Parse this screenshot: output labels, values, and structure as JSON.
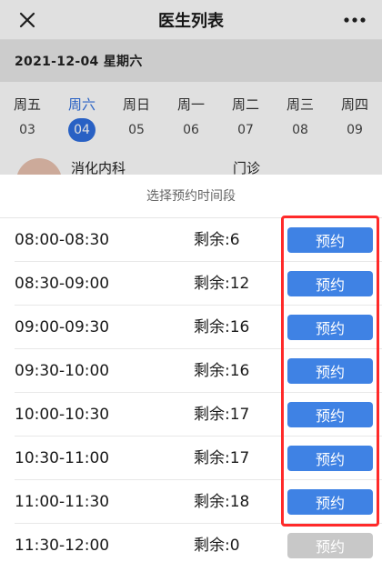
{
  "nav": {
    "title": "医生列表",
    "close_icon": "close-icon",
    "more_icon": "more-icon"
  },
  "date_bar": {
    "text": "2021-12-04 星期六"
  },
  "week": [
    {
      "name": "周五",
      "num": "03",
      "selected": false
    },
    {
      "name": "周六",
      "num": "04",
      "selected": true
    },
    {
      "name": "周日",
      "num": "05",
      "selected": false
    },
    {
      "name": "周一",
      "num": "06",
      "selected": false
    },
    {
      "name": "周二",
      "num": "07",
      "selected": false
    },
    {
      "name": "周三",
      "num": "08",
      "selected": false
    },
    {
      "name": "周四",
      "num": "09",
      "selected": false
    }
  ],
  "doctor": {
    "department": "消化内科",
    "visit_type": "门诊"
  },
  "sheet": {
    "title": "选择预约时间段",
    "slots": [
      {
        "time": "08:00-08:30",
        "remain": "剩余:6",
        "button": "预约",
        "available": true
      },
      {
        "time": "08:30-09:00",
        "remain": "剩余:12",
        "button": "预约",
        "available": true
      },
      {
        "time": "09:00-09:30",
        "remain": "剩余:16",
        "button": "预约",
        "available": true
      },
      {
        "time": "09:30-10:00",
        "remain": "剩余:16",
        "button": "预约",
        "available": true
      },
      {
        "time": "10:00-10:30",
        "remain": "剩余:17",
        "button": "预约",
        "available": true
      },
      {
        "time": "10:30-11:00",
        "remain": "剩余:17",
        "button": "预约",
        "available": true
      },
      {
        "time": "11:00-11:30",
        "remain": "剩余:18",
        "button": "预约",
        "available": true
      },
      {
        "time": "11:30-12:00",
        "remain": "剩余:0",
        "button": "预约",
        "available": false
      }
    ]
  },
  "colors": {
    "accent": "#2f6fe0",
    "button": "#3f82e4",
    "button_disabled": "#c8c8c8",
    "highlight": "#ff2a2a"
  }
}
